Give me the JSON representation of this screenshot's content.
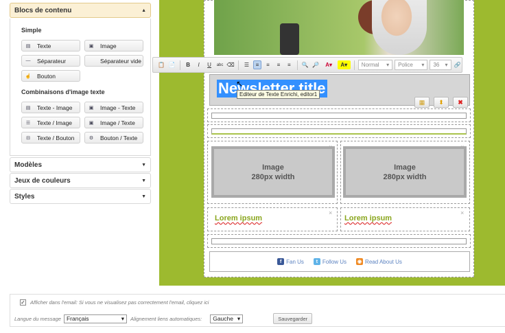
{
  "sidebar": {
    "open_section": "Blocs de contenu",
    "simple_title": "Simple",
    "simple_blocks": [
      {
        "icon": "text-block-icon",
        "glyph": "▤",
        "label": "Texte"
      },
      {
        "icon": "image-block-icon",
        "glyph": "▣",
        "label": "Image"
      },
      {
        "icon": "separator-icon",
        "glyph": "—",
        "label": "Séparateur"
      },
      {
        "icon": "empty-separator-icon",
        "glyph": "",
        "label": "Séparateur vide"
      },
      {
        "icon": "button-block-icon",
        "glyph": "☝",
        "label": "Bouton"
      }
    ],
    "combo_title": "Combinaisons d'image texte",
    "combo_blocks": [
      {
        "icon": "text-image-icon",
        "glyph": "▤",
        "label": "Texte - Image"
      },
      {
        "icon": "image-text-icon",
        "glyph": "▣",
        "label": "Image - Texte"
      },
      {
        "icon": "text-over-image-icon",
        "glyph": "☰",
        "label": "Texte / Image"
      },
      {
        "icon": "image-over-text-icon",
        "glyph": "▣",
        "label": "Image / Texte"
      },
      {
        "icon": "text-over-button-icon",
        "glyph": "⊟",
        "label": "Texte / Bouton"
      },
      {
        "icon": "button-over-text-icon",
        "glyph": "⚙",
        "label": "Bouton / Texte"
      }
    ],
    "collapsed_sections": [
      "Modèles",
      "Jeux de couleurs",
      "Styles"
    ]
  },
  "editor": {
    "toolbar": {
      "format_value": "Normal",
      "font_value": "Police",
      "size_value": "36"
    },
    "title_text": "Newsletter title",
    "tooltip": "Editeur de Texte Enrichi, editor1",
    "image_placeholder_line1": "Image",
    "image_placeholder_line2": "280px width",
    "lorem": "Lorem ipsum",
    "close_glyph": "×",
    "social": [
      {
        "label": "Fan Us",
        "color": "#3b5998",
        "glyph": "f"
      },
      {
        "label": "Follow Us",
        "color": "#5fb3e8",
        "glyph": "t"
      },
      {
        "label": "Read About Us",
        "color": "#f08a24",
        "glyph": "◉"
      }
    ]
  },
  "bottom": {
    "show_email_label": "Afficher dans l'email: Si vous ne visualisez pas correctement l'email, cliquez ici",
    "show_email_checked": "✓",
    "language_label": "Langue du message",
    "language_value": "Français",
    "alignment_label": "Alignement liens automatiques:",
    "alignment_value": "Gauche",
    "save_label": "Sauvegarder"
  }
}
